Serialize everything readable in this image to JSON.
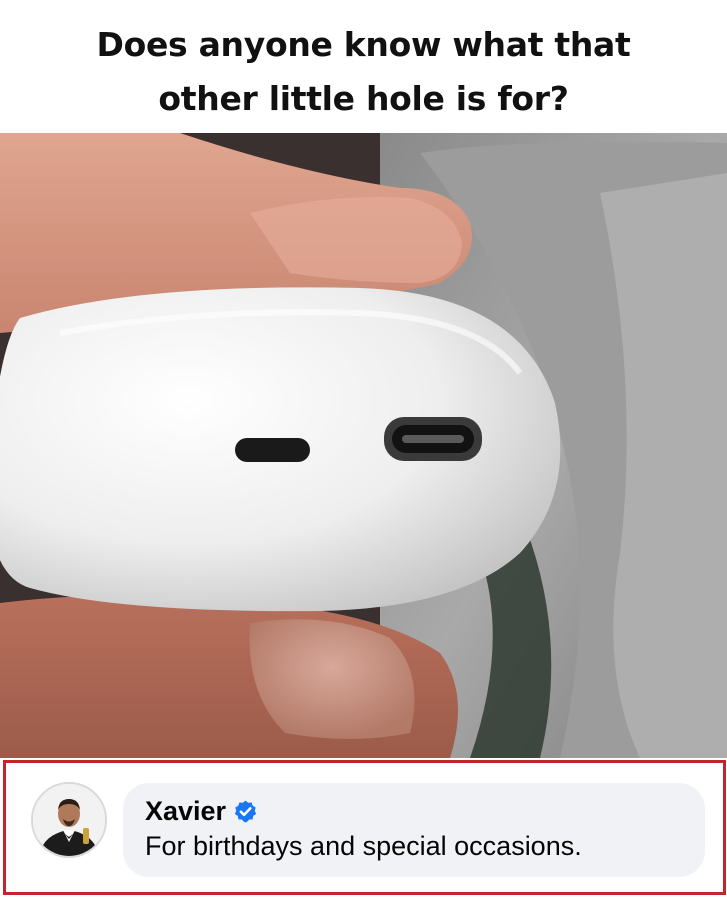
{
  "post": {
    "title_line1": "Does anyone know what that",
    "title_line2": "other little hole is for?"
  },
  "photo": {
    "subject": "white earbuds case held between fingers, showing two holes"
  },
  "comment": {
    "author": "Xavier",
    "verified_icon": "verified-badge-icon",
    "text": "For birthdays and special occasions.",
    "accent_color": "#1877f2",
    "frame_color": "#c0262b"
  }
}
